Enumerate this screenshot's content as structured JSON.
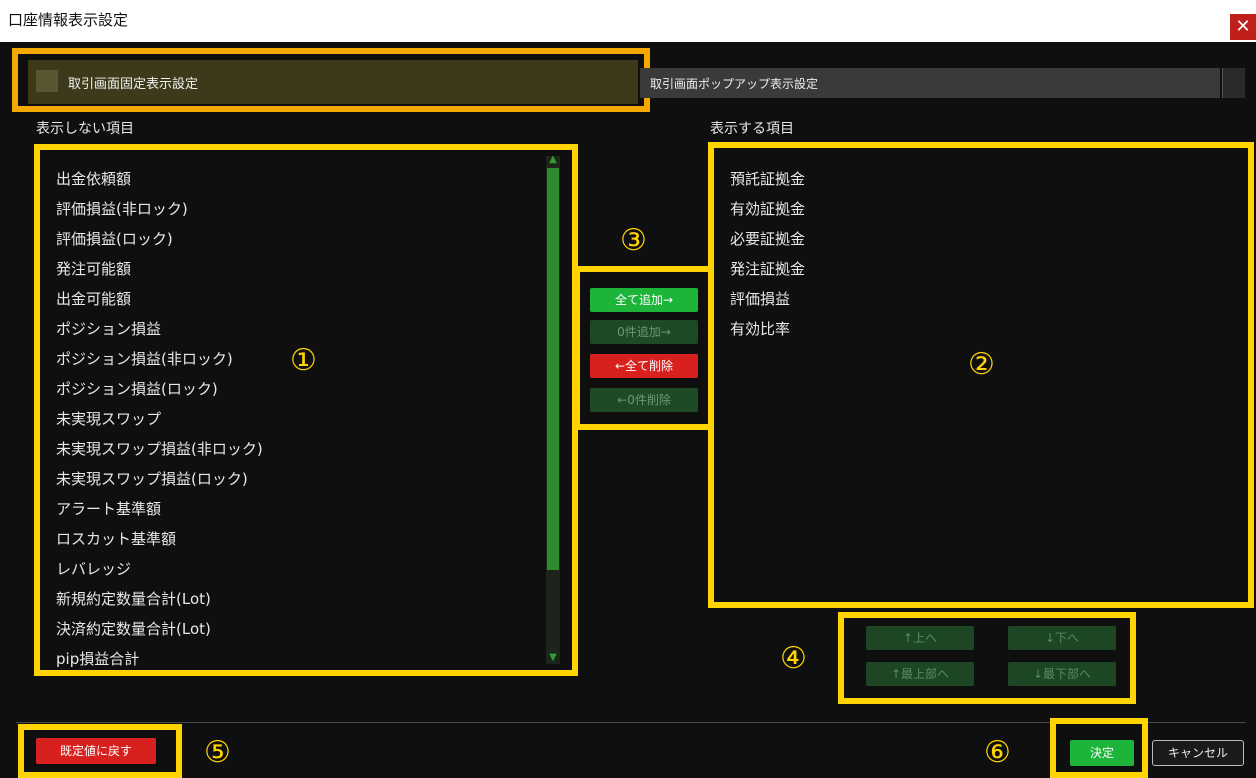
{
  "window": {
    "title": "口座情報表示設定",
    "close_glyph": "✕"
  },
  "tabs": [
    {
      "label": "取引画面固定表示設定",
      "active": true
    },
    {
      "label": "取引画面ポップアップ表示設定",
      "active": false
    }
  ],
  "left_panel": {
    "label": "表示しない項目",
    "items": [
      "出金依頼額",
      "評価損益(非ロック)",
      "評価損益(ロック)",
      "発注可能額",
      "出金可能額",
      "ポジション損益",
      "ポジション損益(非ロック)",
      "ポジション損益(ロック)",
      "未実現スワップ",
      "未実現スワップ損益(非ロック)",
      "未実現スワップ損益(ロック)",
      "アラート基準額",
      "ロスカット基準額",
      "レバレッジ",
      "新規約定数量合計(Lot)",
      "決済約定数量合計(Lot)",
      "pip損益合計"
    ]
  },
  "right_panel": {
    "label": "表示する項目",
    "items": [
      "預託証拠金",
      "有効証拠金",
      "必要証拠金",
      "発注証拠金",
      "評価損益",
      "有効比率"
    ]
  },
  "move_buttons": {
    "add_all": "全て追加→",
    "add_n": "0件追加→",
    "remove_all": "←全て削除",
    "remove_n": "←0件削除"
  },
  "order_buttons": {
    "up": "↑上へ",
    "down": "↓下へ",
    "top": "↑最上部へ",
    "bottom": "↓最下部へ"
  },
  "footer": {
    "reset": "既定値に戻す",
    "ok": "決定",
    "cancel": "キャンセル"
  },
  "markers": [
    "①",
    "②",
    "③",
    "④",
    "⑤",
    "⑥"
  ],
  "colors": {
    "highlight_yellow": "#ffd400",
    "highlight_orange": "#f5a800",
    "accent_green": "#1db43a",
    "accent_red": "#d8201e"
  }
}
